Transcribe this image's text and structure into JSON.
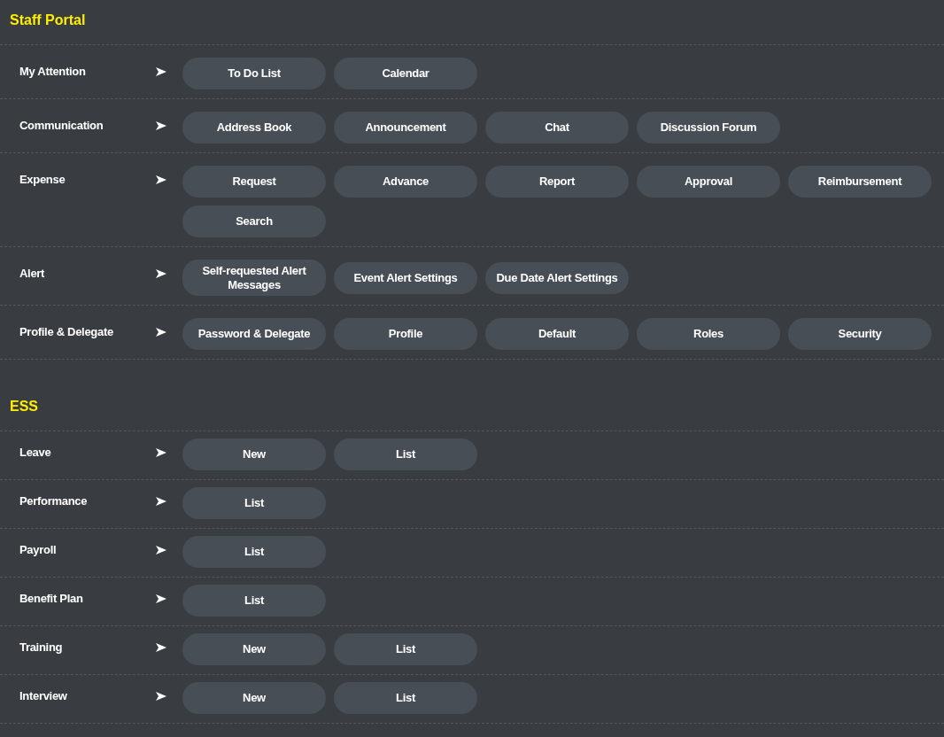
{
  "sections": [
    {
      "title": "Staff Portal",
      "rows": [
        {
          "label": "My Attention",
          "buttons": [
            "To Do List",
            "Calendar"
          ]
        },
        {
          "label": "Communication",
          "buttons": [
            "Address Book",
            "Announcement",
            "Chat",
            "Discussion Forum"
          ]
        },
        {
          "label": "Expense",
          "buttons": [
            "Request",
            "Advance",
            "Report",
            "Approval",
            "Reimbursement",
            "Search"
          ]
        },
        {
          "label": "Alert",
          "buttons": [
            "Self-requested Alert Messages",
            "Event Alert Settings",
            "Due Date Alert Settings"
          ]
        },
        {
          "label": "Profile & Delegate",
          "buttons": [
            "Password & Delegate",
            "Profile",
            "Default",
            "Roles",
            "Security"
          ]
        }
      ]
    },
    {
      "title": "ESS",
      "rows": [
        {
          "label": "Leave",
          "buttons": [
            "New",
            "List"
          ]
        },
        {
          "label": "Performance",
          "buttons": [
            "List"
          ]
        },
        {
          "label": "Payroll",
          "buttons": [
            "List"
          ]
        },
        {
          "label": "Benefit Plan",
          "buttons": [
            "List"
          ]
        },
        {
          "label": "Training",
          "buttons": [
            "New",
            "List"
          ]
        },
        {
          "label": "Interview",
          "buttons": [
            "New",
            "List"
          ]
        }
      ]
    }
  ]
}
